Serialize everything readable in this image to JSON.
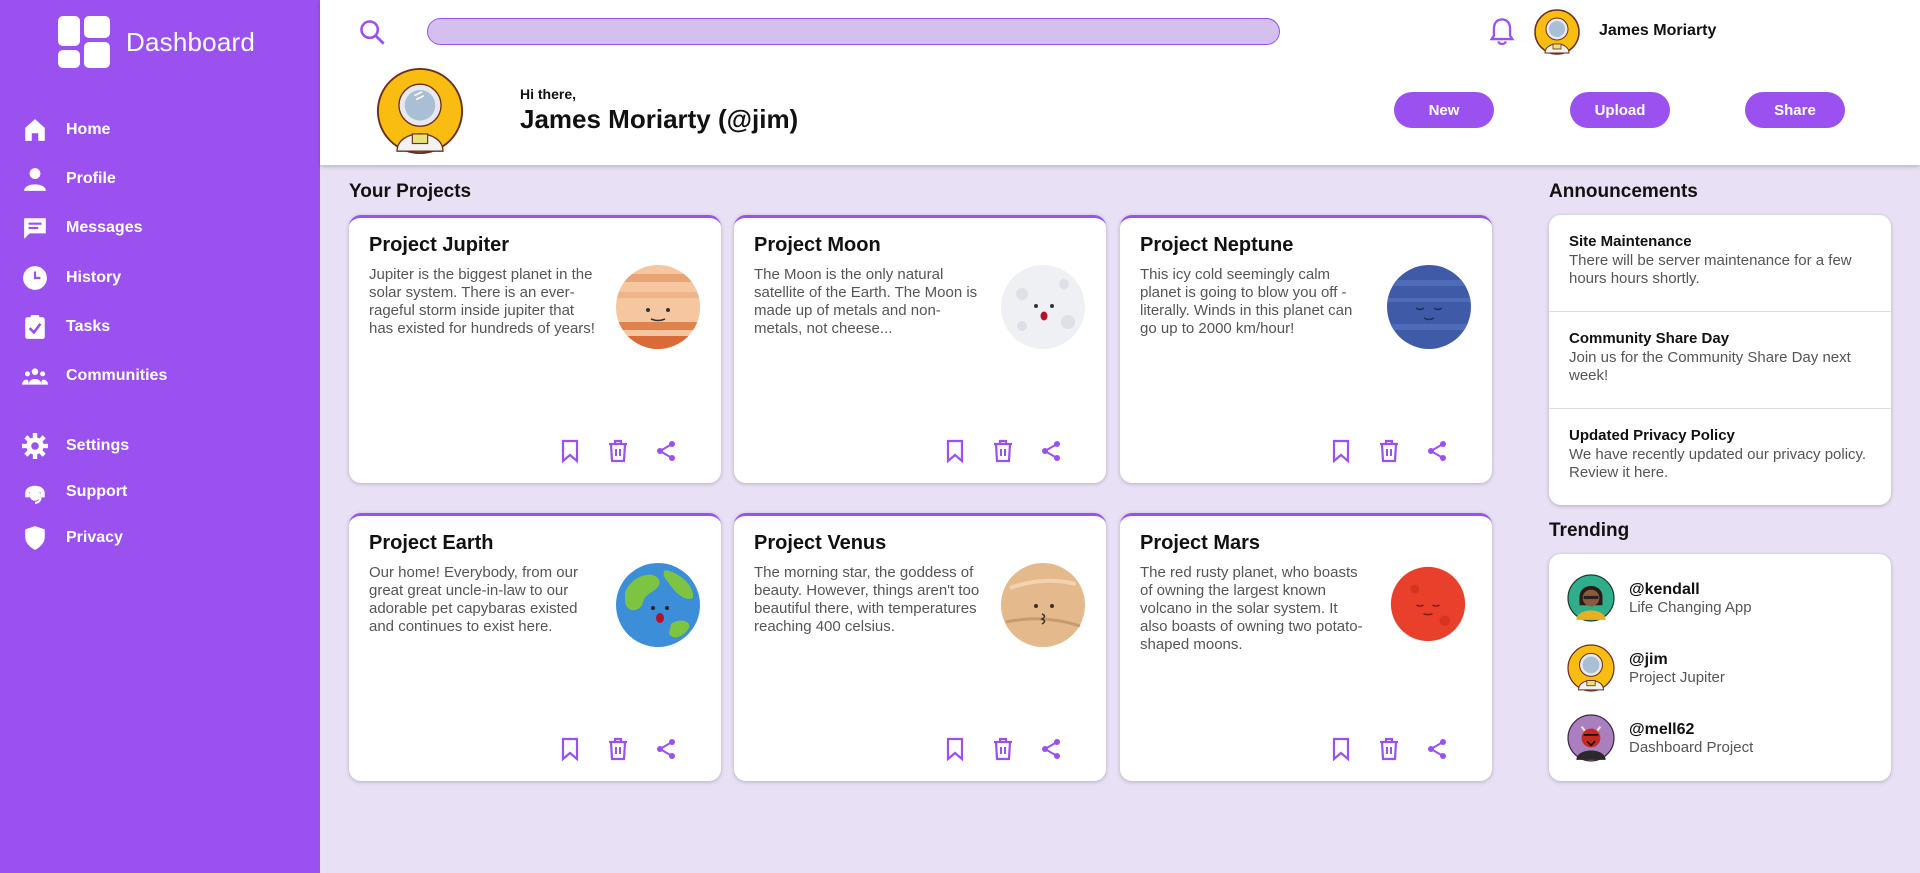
{
  "brand": {
    "title": "Dashboard"
  },
  "nav": [
    {
      "label": "Home",
      "icon": "home-icon"
    },
    {
      "label": "Profile",
      "icon": "profile-icon"
    },
    {
      "label": "Messages",
      "icon": "messages-icon"
    },
    {
      "label": "History",
      "icon": "history-icon"
    },
    {
      "label": "Tasks",
      "icon": "tasks-icon"
    },
    {
      "label": "Communities",
      "icon": "communities-icon"
    },
    {
      "label": "Settings",
      "icon": "gear-icon"
    },
    {
      "label": "Support",
      "icon": "support-icon"
    },
    {
      "label": "Privacy",
      "icon": "shield-icon"
    }
  ],
  "topbar": {
    "search_placeholder": "",
    "user_name": "James Moriarty"
  },
  "greeting": {
    "hi": "Hi there,",
    "name": "James Moriarty (@jim)"
  },
  "actions": {
    "new": "New",
    "upload": "Upload",
    "share": "Share"
  },
  "projects": {
    "title": "Your Projects",
    "items": [
      {
        "title": "Project Jupiter",
        "desc": "Jupiter is the biggest planet in the solar system. There is an ever-rageful storm inside jupiter that has existed for hundreds of years!",
        "planet": "jupiter-illustration"
      },
      {
        "title": "Project Moon",
        "desc": "The Moon is the only natural satellite of the Earth. The Moon is made up of metals and non-metals, not cheese...",
        "planet": "moon-illustration"
      },
      {
        "title": "Project Neptune",
        "desc": "This icy cold seemingly calm planet is going to blow you off - literally. Winds in this planet can go up to 2000 km/hour!",
        "planet": "neptune-illustration"
      },
      {
        "title": "Project Earth",
        "desc": "Our home! Everybody, from our great great uncle-in-law to our adorable pet capybaras existed and continues to exist here.",
        "planet": "earth-illustration"
      },
      {
        "title": "Project Venus",
        "desc": "The morning star, the goddess of beauty. However, things aren't too beautiful there, with temperatures reaching 400 celsius.",
        "planet": "venus-illustration"
      },
      {
        "title": "Project Mars",
        "desc": "The red rusty planet, who boasts of owning the largest known volcano in the solar system. It also boasts of owning two potato-shaped moons.",
        "planet": "mars-illustration"
      }
    ]
  },
  "announcements": {
    "title": "Announcements",
    "items": [
      {
        "title": "Site Maintenance",
        "body": "There will be server maintenance for a few hours hours shortly."
      },
      {
        "title": "Community Share Day",
        "body": "Join us for the Community Share Day next week!"
      },
      {
        "title": "Updated Privacy Policy",
        "body": "We have recently updated our privacy policy. Review it here."
      }
    ]
  },
  "trending": {
    "title": "Trending",
    "items": [
      {
        "handle": "@kendall",
        "project": "Life Changing App"
      },
      {
        "handle": "@jim",
        "project": "Project Jupiter"
      },
      {
        "handle": "@mell62",
        "project": "Dashboard Project"
      }
    ]
  },
  "colors": {
    "accent": "#9b51f0",
    "background": "#e8e0f4",
    "search_fill": "#d4c0ef"
  }
}
